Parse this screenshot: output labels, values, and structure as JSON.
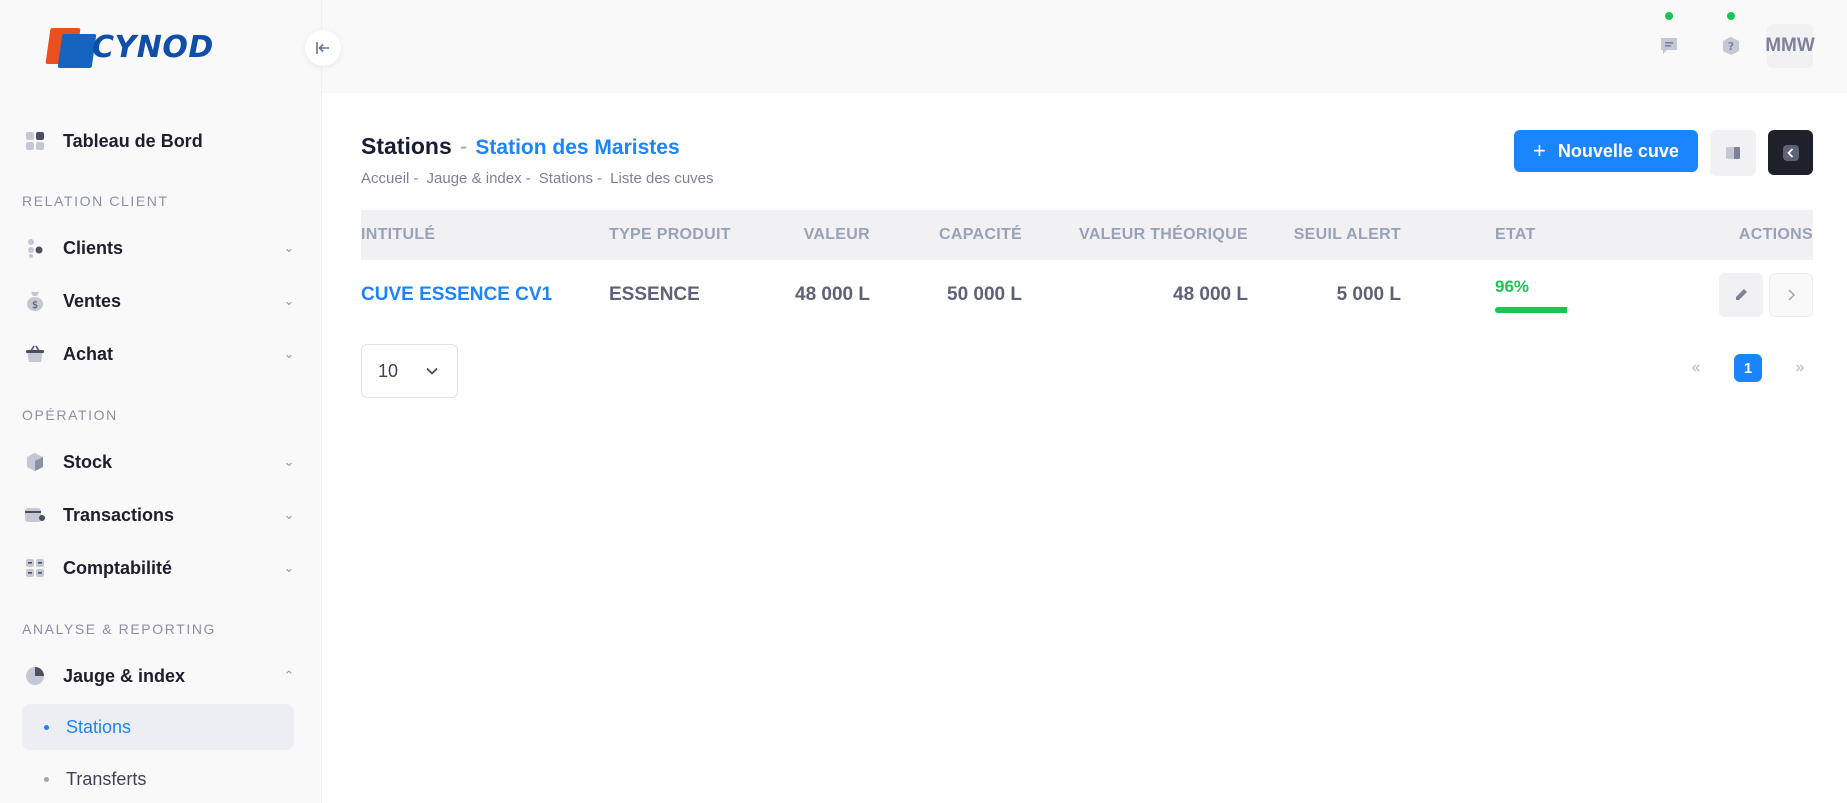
{
  "brand": {
    "name": "CYNOD"
  },
  "sidebar": {
    "items": [
      {
        "label": "Tableau de Bord"
      },
      {
        "section": "RELATION CLIENT"
      },
      {
        "label": "Clients"
      },
      {
        "label": "Ventes"
      },
      {
        "label": "Achat"
      },
      {
        "section": "OPÉRATION"
      },
      {
        "label": "Stock"
      },
      {
        "label": "Transactions"
      },
      {
        "label": "Comptabilité"
      },
      {
        "section": "ANALYSE & REPORTING"
      },
      {
        "label": "Jauge & index"
      }
    ],
    "subitems": [
      {
        "label": "Stations"
      },
      {
        "label": "Transferts"
      }
    ]
  },
  "header": {
    "user_initials": "MMW"
  },
  "page": {
    "title": "Stations",
    "separator": "-",
    "subtitle": "Station des Maristes",
    "breadcrumb": [
      "Accueil -",
      "Jauge & index -",
      "Stations -",
      "Liste des cuves"
    ],
    "new_button": "Nouvelle cuve"
  },
  "table": {
    "headers": [
      "INTITULÉ",
      "TYPE PRODUIT",
      "VALEUR",
      "CAPACITÉ",
      "VALEUR THÉORIQUE",
      "SEUIL ALERT",
      "ETAT",
      "ACTIONS"
    ],
    "rows": [
      {
        "intitule": "CUVE ESSENCE CV1",
        "type": "ESSENCE",
        "valeur": "48 000 L",
        "capacite": "50 000 L",
        "valeur_theorique": "48 000 L",
        "seuil": "5 000 L",
        "etat": "96%",
        "etat_value": 96
      }
    ]
  },
  "pagination": {
    "page_size": "10",
    "prev": "«",
    "current": "1",
    "next": "»"
  },
  "colors": {
    "primary": "#1b84ff",
    "success": "#17c653",
    "dark": "#1e2129"
  }
}
